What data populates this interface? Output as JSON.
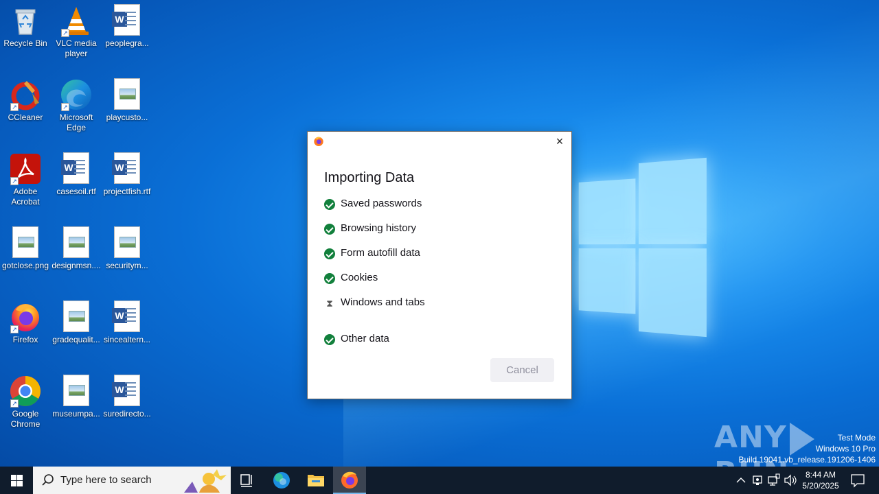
{
  "desktop": {
    "icons": [
      {
        "label": "Recycle Bin"
      },
      {
        "label": "VLC media player"
      },
      {
        "label": "peoplegra..."
      },
      {
        "label": "CCleaner"
      },
      {
        "label": "Microsoft Edge"
      },
      {
        "label": "playcusto..."
      },
      {
        "label": "Adobe Acrobat"
      },
      {
        "label": "casesoil.rtf"
      },
      {
        "label": "projectfish.rtf"
      },
      {
        "label": "gotclose.png"
      },
      {
        "label": "designmsn...."
      },
      {
        "label": "securitym..."
      },
      {
        "label": "Firefox"
      },
      {
        "label": "gradequalit..."
      },
      {
        "label": "sincealtern..."
      },
      {
        "label": "Google Chrome"
      },
      {
        "label": "museumpa..."
      },
      {
        "label": "suredirecto..."
      }
    ]
  },
  "dialog": {
    "title": "Importing Data",
    "items": [
      {
        "label": "Saved passwords",
        "status": "done"
      },
      {
        "label": "Browsing history",
        "status": "done"
      },
      {
        "label": "Form autofill data",
        "status": "done"
      },
      {
        "label": "Cookies",
        "status": "done"
      },
      {
        "label": "Windows and tabs",
        "status": "pending"
      },
      {
        "label": "Other data",
        "status": "done"
      }
    ],
    "cancel_label": "Cancel",
    "close_icon": "×",
    "colors": {
      "check": "#12803c",
      "cancel_bg": "#f0f0f4",
      "cancel_text": "#8f8f9d"
    }
  },
  "watermark": {
    "text_left": "ANY",
    "text_right": "RUN",
    "line1": "Test Mode",
    "line2": "Windows 10 Pro",
    "line3": "Build 19041.vb_release.191206-1406"
  },
  "taskbar": {
    "search_placeholder": "Type here to search",
    "time": "8:44 AM",
    "date": "5/20/2025",
    "colors": {
      "bg": "#101c2c"
    }
  }
}
